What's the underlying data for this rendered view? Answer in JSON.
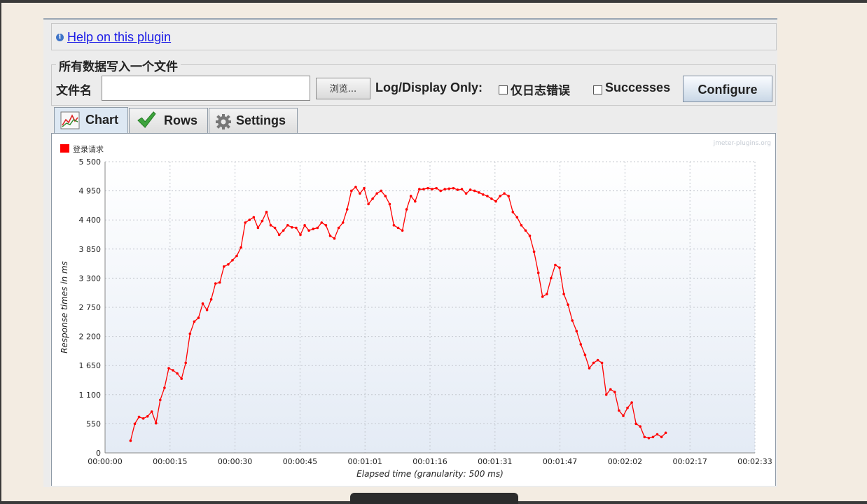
{
  "help": {
    "link_text": "Help on this plugin"
  },
  "file_group": {
    "title": "所有数据写入一个文件",
    "filename_label": "文件名",
    "filename_value": "",
    "browse_label": "浏览...",
    "log_display_label": "Log/Display Only:",
    "errors_label": "仅日志错误",
    "successes_label": "Successes",
    "configure_label": "Configure"
  },
  "tabs": [
    {
      "label": "Chart",
      "icon": "chart-icon",
      "active": true
    },
    {
      "label": "Rows",
      "icon": "checkmark-icon",
      "active": false
    },
    {
      "label": "Settings",
      "icon": "gear-icon",
      "active": false
    }
  ],
  "chart_data": {
    "type": "line",
    "watermark": "jmeter-plugins.org",
    "legend": {
      "placement": "top-left"
    },
    "series": [
      {
        "name": "登录请求",
        "color": "#ff0000"
      }
    ],
    "xlabel": "Elapsed time (granularity: 500 ms)",
    "ylabel": "Response times in ms",
    "x_ticks": [
      "00:00:00",
      "00:00:15",
      "00:00:30",
      "00:00:45",
      "00:01:01",
      "00:01:16",
      "00:01:31",
      "00:01:47",
      "00:02:02",
      "00:02:17",
      "00:02:33"
    ],
    "y_ticks": [
      "0",
      "550",
      "1 100",
      "1 650",
      "2 200",
      "2 750",
      "3 300",
      "3 850",
      "4 400",
      "4 950",
      "5 500"
    ],
    "xlim_seconds": [
      0,
      153
    ],
    "ylim": [
      0,
      5500
    ],
    "grid": true,
    "points": [
      [
        6,
        230
      ],
      [
        7,
        550
      ],
      [
        8,
        680
      ],
      [
        9,
        650
      ],
      [
        10,
        690
      ],
      [
        11,
        780
      ],
      [
        12,
        560
      ],
      [
        13,
        1000
      ],
      [
        14,
        1230
      ],
      [
        15,
        1600
      ],
      [
        16,
        1560
      ],
      [
        17,
        1500
      ],
      [
        18,
        1400
      ],
      [
        19,
        1700
      ],
      [
        20,
        2250
      ],
      [
        21,
        2480
      ],
      [
        22,
        2550
      ],
      [
        23,
        2820
      ],
      [
        24,
        2700
      ],
      [
        25,
        2900
      ],
      [
        26,
        3200
      ],
      [
        27,
        3220
      ],
      [
        28,
        3520
      ],
      [
        29,
        3560
      ],
      [
        30,
        3640
      ],
      [
        31,
        3720
      ],
      [
        32,
        3880
      ],
      [
        33,
        4350
      ],
      [
        34,
        4400
      ],
      [
        35,
        4450
      ],
      [
        36,
        4250
      ],
      [
        37,
        4380
      ],
      [
        38,
        4550
      ],
      [
        39,
        4300
      ],
      [
        40,
        4250
      ],
      [
        41,
        4120
      ],
      [
        42,
        4200
      ],
      [
        43,
        4300
      ],
      [
        44,
        4260
      ],
      [
        45,
        4250
      ],
      [
        46,
        4120
      ],
      [
        47,
        4300
      ],
      [
        48,
        4200
      ],
      [
        49,
        4230
      ],
      [
        50,
        4250
      ],
      [
        51,
        4350
      ],
      [
        52,
        4300
      ],
      [
        53,
        4100
      ],
      [
        54,
        4050
      ],
      [
        55,
        4250
      ],
      [
        56,
        4350
      ],
      [
        57,
        4600
      ],
      [
        58,
        4950
      ],
      [
        59,
        5020
      ],
      [
        60,
        4900
      ],
      [
        61,
        5000
      ],
      [
        62,
        4700
      ],
      [
        63,
        4800
      ],
      [
        64,
        4900
      ],
      [
        65,
        4950
      ],
      [
        66,
        4850
      ],
      [
        67,
        4700
      ],
      [
        68,
        4300
      ],
      [
        69,
        4250
      ],
      [
        70,
        4200
      ],
      [
        71,
        4600
      ],
      [
        72,
        4850
      ],
      [
        73,
        4750
      ],
      [
        74,
        4980
      ],
      [
        75,
        4980
      ],
      [
        76,
        5000
      ],
      [
        77,
        4980
      ],
      [
        78,
        5000
      ],
      [
        79,
        4950
      ],
      [
        80,
        4980
      ],
      [
        81,
        4990
      ],
      [
        82,
        5000
      ],
      [
        83,
        4970
      ],
      [
        84,
        4980
      ],
      [
        85,
        4900
      ],
      [
        86,
        4970
      ],
      [
        87,
        4950
      ],
      [
        88,
        4920
      ],
      [
        89,
        4880
      ],
      [
        90,
        4850
      ],
      [
        91,
        4800
      ],
      [
        92,
        4750
      ],
      [
        93,
        4850
      ],
      [
        94,
        4900
      ],
      [
        95,
        4850
      ],
      [
        96,
        4550
      ],
      [
        97,
        4450
      ],
      [
        98,
        4300
      ],
      [
        99,
        4200
      ],
      [
        100,
        4100
      ],
      [
        101,
        3800
      ],
      [
        102,
        3400
      ],
      [
        103,
        2950
      ],
      [
        104,
        3000
      ],
      [
        105,
        3300
      ],
      [
        106,
        3550
      ],
      [
        107,
        3500
      ],
      [
        108,
        3000
      ],
      [
        109,
        2800
      ],
      [
        110,
        2500
      ],
      [
        111,
        2300
      ],
      [
        112,
        2050
      ],
      [
        113,
        1850
      ],
      [
        114,
        1600
      ],
      [
        115,
        1700
      ],
      [
        116,
        1750
      ],
      [
        117,
        1700
      ],
      [
        118,
        1100
      ],
      [
        119,
        1200
      ],
      [
        120,
        1150
      ],
      [
        121,
        800
      ],
      [
        122,
        700
      ],
      [
        123,
        850
      ],
      [
        124,
        950
      ],
      [
        125,
        550
      ],
      [
        126,
        500
      ],
      [
        127,
        300
      ],
      [
        128,
        280
      ],
      [
        129,
        300
      ],
      [
        130,
        350
      ],
      [
        131,
        300
      ],
      [
        132,
        380
      ]
    ]
  }
}
